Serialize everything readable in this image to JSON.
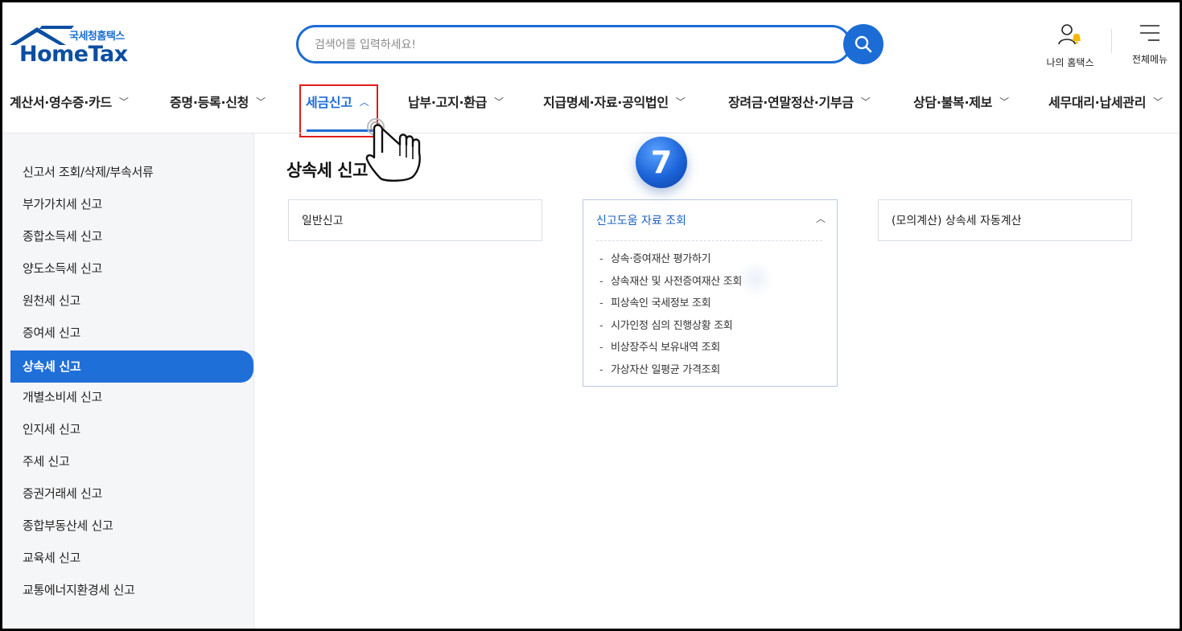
{
  "header": {
    "logo_sub": "국세청홈택스",
    "logo_main": "HomeTax",
    "search_placeholder": "검색어를 입력하세요!",
    "my_hometax_label": "나의 홈택스",
    "all_menu_label": "전체메뉴"
  },
  "gnb": {
    "items": [
      {
        "label": "계산서·영수증·카드"
      },
      {
        "label": "증명·등록·신청"
      },
      {
        "label": "세금신고",
        "active": true
      },
      {
        "label": "납부·고지·환급"
      },
      {
        "label": "지급명세·자료·공익법인"
      },
      {
        "label": "장려금·연말정산·기부금"
      },
      {
        "label": "상담·불복·제보"
      },
      {
        "label": "세무대리·납세관리"
      }
    ]
  },
  "sidebar": {
    "items": [
      {
        "label": "신고서 조회/삭제/부속서류"
      },
      {
        "label": "부가가치세 신고"
      },
      {
        "label": "종합소득세 신고"
      },
      {
        "label": "양도소득세 신고"
      },
      {
        "label": "원천세 신고"
      },
      {
        "label": "증여세 신고"
      },
      {
        "label": "상속세 신고",
        "active": true
      },
      {
        "label": "개별소비세 신고"
      },
      {
        "label": "인지세 신고"
      },
      {
        "label": "주세 신고"
      },
      {
        "label": "증권거래세 신고"
      },
      {
        "label": "종합부동산세 신고"
      },
      {
        "label": "교육세 신고"
      },
      {
        "label": "교통에너지환경세 신고"
      }
    ]
  },
  "main": {
    "title": "상속세 신고",
    "cards": [
      {
        "title": "일반신고"
      },
      {
        "title": "신고도움 자료 조회",
        "expanded": true,
        "items": [
          "상속·증여재산 평가하기",
          "상속재산 및 사전증여재산 조회",
          "피상속인 국세정보 조회",
          "시가인정 심의 진행상황 조회",
          "비상장주식 보유내역 조회",
          "가상자산 일평균 가격조회"
        ]
      },
      {
        "title": "(모의계산) 상속세 자동계산"
      }
    ]
  },
  "overlay": {
    "step_number": "7"
  },
  "colors": {
    "brand_blue": "#1c6cd6",
    "highlight_red": "#e21b1b",
    "sidebar_bg": "#f5f6f8"
  },
  "icons": [
    "search-icon",
    "my-hometax-user-bell-icon",
    "all-menu-hamburger-icon",
    "chevron-down-icon",
    "chevron-up-icon",
    "pointer-hand-cursor-icon"
  ]
}
